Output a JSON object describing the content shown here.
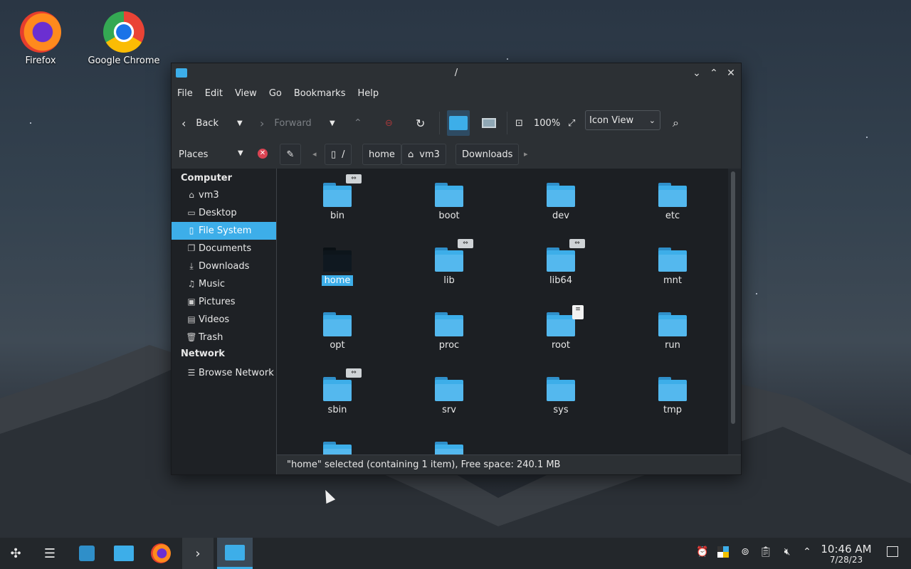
{
  "desktop": {
    "icons": [
      {
        "label": "Firefox",
        "icon": "firefox-icon"
      },
      {
        "label": "Google Chrome",
        "icon": "chrome-icon"
      }
    ]
  },
  "window": {
    "title": "/",
    "menu": [
      "File",
      "Edit",
      "View",
      "Go",
      "Bookmarks",
      "Help"
    ],
    "toolbar": {
      "back": "Back",
      "forward": "Forward",
      "zoom": "100%",
      "view_mode": "Icon View"
    },
    "places_label": "Places",
    "breadcrumb": [
      "/",
      "home",
      "vm3",
      "Downloads"
    ],
    "sidebar": {
      "sections": [
        {
          "title": "Computer",
          "items": [
            {
              "label": "vm3",
              "icon": "home-icon"
            },
            {
              "label": "Desktop",
              "icon": "desktop-icon"
            },
            {
              "label": "File System",
              "icon": "drive-icon",
              "selected": true
            },
            {
              "label": "Documents",
              "icon": "documents-icon"
            },
            {
              "label": "Downloads",
              "icon": "download-icon"
            },
            {
              "label": "Music",
              "icon": "music-icon"
            },
            {
              "label": "Pictures",
              "icon": "pictures-icon"
            },
            {
              "label": "Videos",
              "icon": "videos-icon"
            },
            {
              "label": "Trash",
              "icon": "trash-icon"
            }
          ]
        },
        {
          "title": "Network",
          "items": [
            {
              "label": "Browse Network",
              "icon": "network-icon"
            }
          ]
        }
      ]
    },
    "files": [
      {
        "name": "bin",
        "emblem": "link"
      },
      {
        "name": "boot"
      },
      {
        "name": "dev"
      },
      {
        "name": "etc"
      },
      {
        "name": "home",
        "selected": true
      },
      {
        "name": "lib",
        "emblem": "link"
      },
      {
        "name": "lib64",
        "emblem": "link"
      },
      {
        "name": "mnt"
      },
      {
        "name": "opt"
      },
      {
        "name": "proc"
      },
      {
        "name": "root",
        "emblem": "doc"
      },
      {
        "name": "run"
      },
      {
        "name": "sbin",
        "emblem": "link"
      },
      {
        "name": "srv"
      },
      {
        "name": "sys"
      },
      {
        "name": "tmp"
      },
      {
        "name": ""
      },
      {
        "name": ""
      }
    ],
    "status": "\"home\" selected (containing 1 item), Free space: 240.1 MB"
  },
  "taskbar": {
    "time": "10:46 AM",
    "date": "7/28/23"
  },
  "colors": {
    "accent": "#3daee9",
    "window_bg": "#23272c"
  }
}
